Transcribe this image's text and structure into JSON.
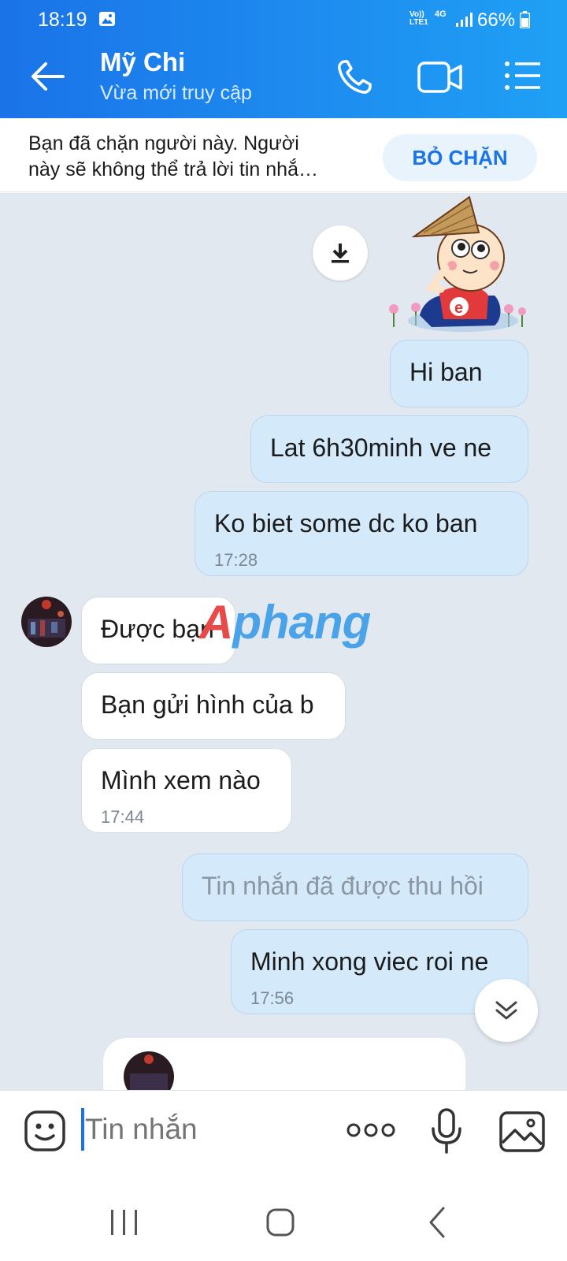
{
  "status_bar": {
    "time": "18:19",
    "network_label_top": "Vo))",
    "network_label_bottom": "LTE1",
    "network_type": "4G",
    "battery": "66%"
  },
  "header": {
    "contact_name": "Mỹ Chi",
    "status": "Vừa mới truy cập"
  },
  "block_notice": {
    "line1": "Bạn đã chặn người này. Người",
    "line2": "này sẽ không thể trả lời tin nhắ…",
    "unblock_label": "BỎ CHẶN"
  },
  "messages": [
    {
      "sender": "me",
      "text": "Hi ban"
    },
    {
      "sender": "me",
      "text": "Lat 6h30minh ve ne"
    },
    {
      "sender": "me",
      "text": "Ko biet some dc ko ban",
      "time": "17:28"
    },
    {
      "sender": "them",
      "text": "Được bạn"
    },
    {
      "sender": "them",
      "text": "Bạn gửi hình của b"
    },
    {
      "sender": "them",
      "text": "Mình xem nào",
      "time": "17:44"
    },
    {
      "sender": "me",
      "text": "Tin nhắn đã được thu hồi",
      "recalled": true
    },
    {
      "sender": "me",
      "text": "Minh xong viec roi ne",
      "time": "17:56"
    }
  ],
  "watermark": {
    "part1": "A",
    "part2": "phang"
  },
  "composer": {
    "placeholder": "Tin nhắn"
  },
  "colors": {
    "header_blue": "#1a73e8",
    "my_bubble": "#d4eafb",
    "their_bubble": "#ffffff",
    "chat_bg": "#e2e8ef",
    "unblock_text": "#1a73e8"
  }
}
